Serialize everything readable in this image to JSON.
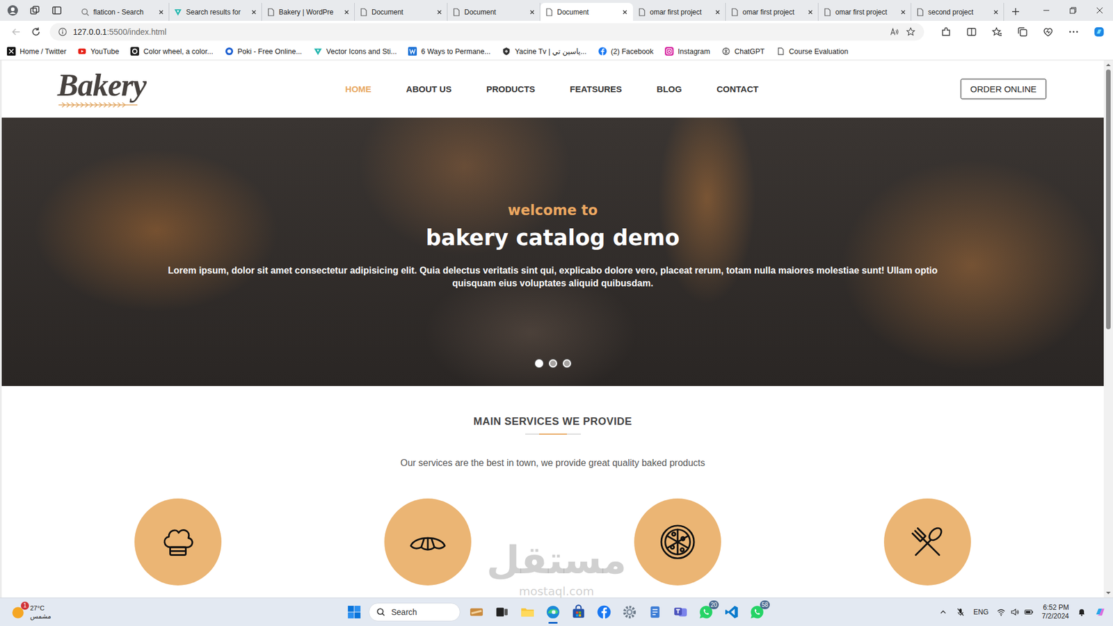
{
  "browser": {
    "tabs": [
      {
        "label": "flaticon - Search",
        "kind": "search",
        "selected": false
      },
      {
        "label": "Search results for",
        "kind": "vector",
        "selected": false
      },
      {
        "label": "Bakery | WordPre",
        "kind": "page",
        "selected": false
      },
      {
        "label": "Document",
        "kind": "page",
        "selected": false
      },
      {
        "label": "Document",
        "kind": "page",
        "selected": false
      },
      {
        "label": "Document",
        "kind": "page",
        "selected": true
      },
      {
        "label": "omar first project",
        "kind": "page",
        "selected": false
      },
      {
        "label": "omar first project",
        "kind": "page",
        "selected": false
      },
      {
        "label": "omar first project",
        "kind": "page",
        "selected": false
      },
      {
        "label": "second project",
        "kind": "page",
        "selected": false
      }
    ],
    "address": {
      "host": "127.0.0.1",
      "path": ":5500/index.html"
    },
    "bookmarks": [
      {
        "label": "Home / Twitter",
        "kind": "x"
      },
      {
        "label": "YouTube",
        "kind": "youtube"
      },
      {
        "label": "Color wheel, a color...",
        "kind": "colorwheel"
      },
      {
        "label": "Poki - Free Online...",
        "kind": "poki"
      },
      {
        "label": "Vector Icons and Sti...",
        "kind": "vector"
      },
      {
        "label": "6 Ways to Permane...",
        "kind": "wsite"
      },
      {
        "label": "Yacine Tv | ياسين تي...",
        "kind": "yacine"
      },
      {
        "label": "(2) Facebook",
        "kind": "facebook"
      },
      {
        "label": "Instagram",
        "kind": "instagram"
      },
      {
        "label": "ChatGPT",
        "kind": "chatgpt"
      },
      {
        "label": "Course Evaluation",
        "kind": "page"
      }
    ]
  },
  "page": {
    "logo": "Bakery",
    "nav": [
      {
        "label": "HOME",
        "selected": true
      },
      {
        "label": "ABOUT US",
        "selected": false
      },
      {
        "label": "PRODUCTS",
        "selected": false
      },
      {
        "label": "FEATSURES",
        "selected": false
      },
      {
        "label": "BLOG",
        "selected": false
      },
      {
        "label": "CONTACT",
        "selected": false
      }
    ],
    "order_button": "ORDER ONLINE",
    "hero": {
      "kicker": "welcome to",
      "title": "bakery catalog demo",
      "text": "Lorem ipsum, dolor sit amet consectetur adipisicing elit. Quia delectus veritatis sint qui, explicabo dolore vero, placeat rerum, totam nulla maiores molestiae sunt! Ullam optio quisquam eius voluptates aliquid quibusdam.",
      "dots": [
        {
          "selected": true
        },
        {
          "selected": false
        },
        {
          "selected": false
        }
      ]
    },
    "services": {
      "title": "MAIN SERVICES WE PROVIDE",
      "subtitle": "Our services are the best in town, we provide great quality baked products",
      "items": [
        {
          "kind": "chef"
        },
        {
          "kind": "croissant"
        },
        {
          "kind": "pizza"
        },
        {
          "kind": "cutlery"
        }
      ]
    }
  },
  "watermark": {
    "arabic": "مستقل",
    "latin": "mostaql.com"
  },
  "taskbar": {
    "weather": {
      "temp": "27°C",
      "condition": "مشمس",
      "badge": "1"
    },
    "search": "Search",
    "apps": [
      {
        "kind": "widgets",
        "badge": "",
        "active": false
      },
      {
        "kind": "taskview",
        "badge": "",
        "active": false
      },
      {
        "kind": "explorer",
        "badge": "",
        "active": false
      },
      {
        "kind": "edge",
        "badge": "",
        "active": true
      },
      {
        "kind": "store",
        "badge": "",
        "active": false
      },
      {
        "kind": "facebook",
        "badge": "",
        "active": false
      },
      {
        "kind": "settings",
        "badge": "",
        "active": false
      },
      {
        "kind": "notepad",
        "badge": "",
        "active": false
      },
      {
        "kind": "teams",
        "badge": "",
        "active": false
      },
      {
        "kind": "whatsapp",
        "badge": "20",
        "active": false
      },
      {
        "kind": "vscode",
        "badge": "",
        "active": false
      },
      {
        "kind": "whatsapp",
        "badge": "58",
        "active": false
      }
    ],
    "tray": {
      "language": "ENG",
      "time": "6:52 PM",
      "date": "7/2/2024"
    }
  }
}
